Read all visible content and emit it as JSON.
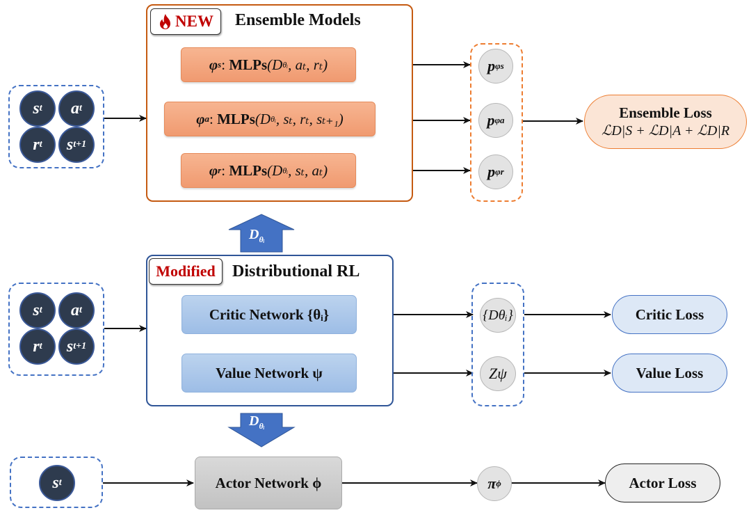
{
  "ensemble": {
    "tag_icon": "fire-icon",
    "tag_label": "NEW",
    "title": "Ensemble Models",
    "mlps": [
      {
        "param": "φ",
        "param_sub": "s",
        "fn": "MLPs",
        "args": "(D",
        "args_sub": "θᵢ",
        "args_rest": ", aₜ, rₜ)"
      },
      {
        "param": "φ",
        "param_sub": "a",
        "fn": "MLPs",
        "args": "(D",
        "args_sub": "θᵢ",
        "args_rest": ", sₜ, rₜ, sₜ₊₁)"
      },
      {
        "param": "φ",
        "param_sub": "r",
        "fn": "MLPs",
        "args": "(D",
        "args_sub": "θᵢ",
        "args_rest": ", sₜ, aₜ)"
      }
    ],
    "outputs": [
      {
        "base": "p",
        "sub": "φs"
      },
      {
        "base": "p",
        "sub": "φa"
      },
      {
        "base": "p",
        "sub": "φr"
      }
    ],
    "loss_title": "Ensemble Loss",
    "loss_formula": "ℒD|S + ℒD|A + ℒD|R"
  },
  "inputs_top": [
    {
      "base": "s",
      "sub": "t"
    },
    {
      "base": "a",
      "sub": "t"
    },
    {
      "base": "r",
      "sub": "t"
    },
    {
      "base": "s",
      "sub": "t+1"
    }
  ],
  "inputs_mid": [
    {
      "base": "s",
      "sub": "t"
    },
    {
      "base": "a",
      "sub": "t"
    },
    {
      "base": "r",
      "sub": "t"
    },
    {
      "base": "s",
      "sub": "t+1"
    }
  ],
  "input_bottom": {
    "base": "s",
    "sub": "t"
  },
  "up_arrow": {
    "base": "D",
    "sub": "θᵢ"
  },
  "down_arrow": {
    "base": "D",
    "sub": "θᵢ"
  },
  "distributional": {
    "tag_label": "Modified",
    "title": "Distributional RL",
    "critic_label": "Critic Network {θᵢ}",
    "value_label": "Value Network ψ",
    "critic_out": "{Dθᵢ}",
    "value_out": "Zψ",
    "critic_loss": "Critic Loss",
    "value_loss": "Value Loss"
  },
  "actor": {
    "label": "Actor Network ϕ",
    "out_base": "π",
    "out_sub": "ϕ",
    "loss": "Actor Loss"
  },
  "colors": {
    "orange_border": "#c55a11",
    "orange_fill": "#f4a57f",
    "blue_border": "#2f5597",
    "blue_fill": "#aec9ea",
    "dashed_blue": "#4472c4",
    "dashed_orange": "#ed7d31",
    "node_fill": "#2e3b4e",
    "tag_red": "#c00000",
    "arrow_blue": "#4472c4"
  }
}
